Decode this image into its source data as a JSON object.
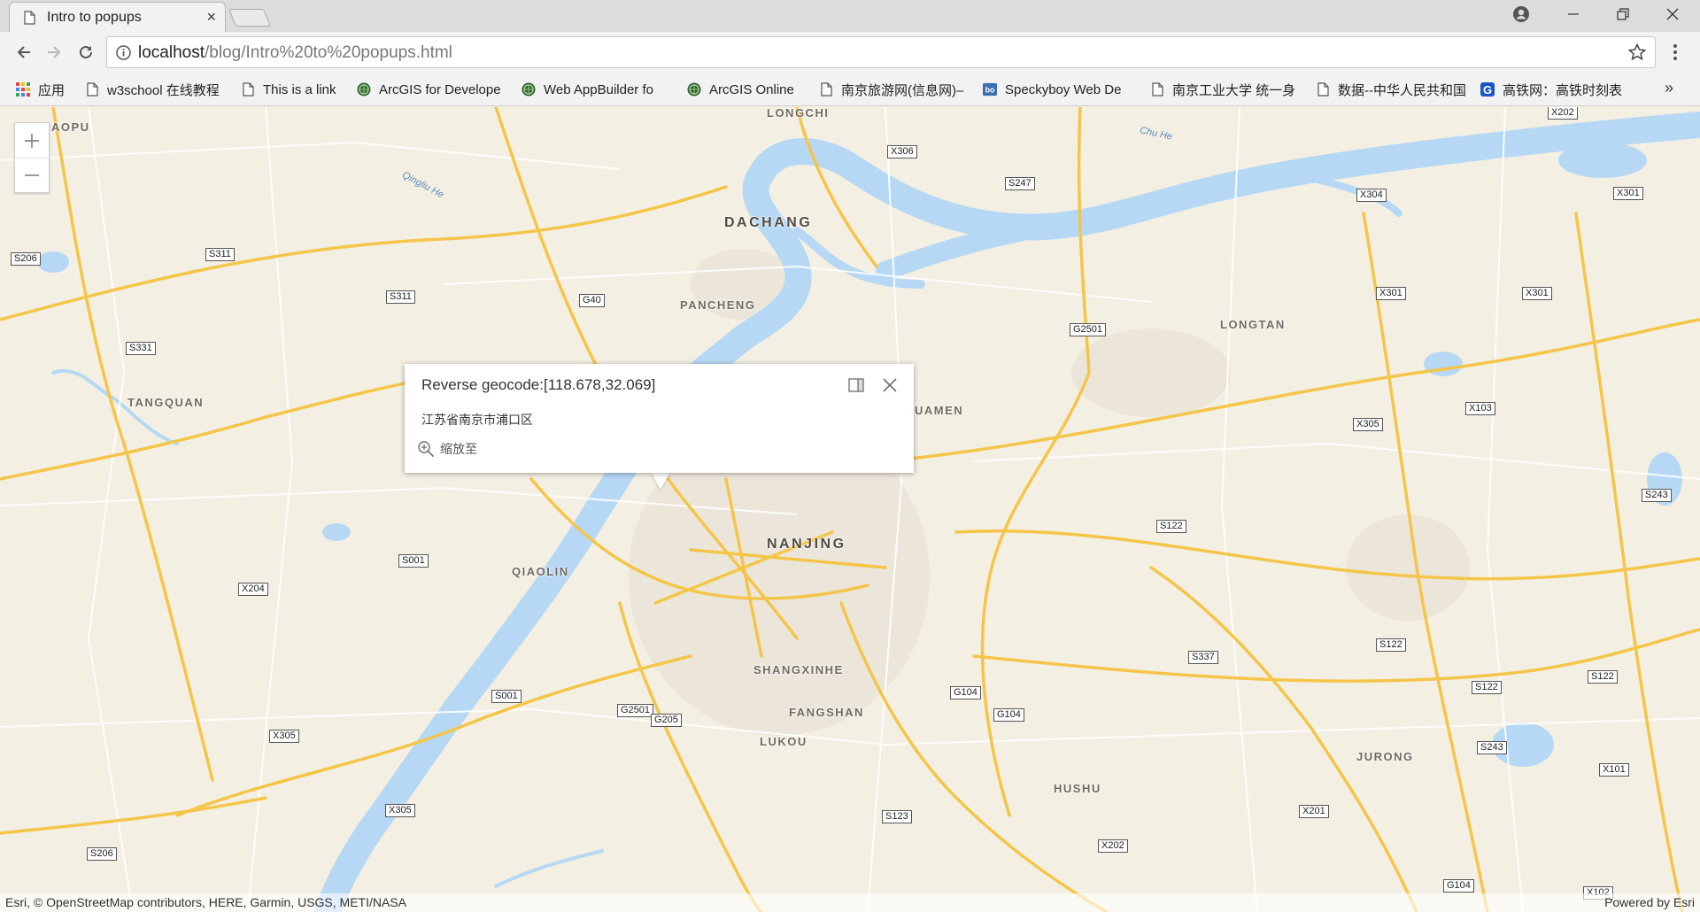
{
  "browser": {
    "tab_title": "Intro to popups",
    "tab_close_glyph": "×",
    "url_host": "localhost",
    "url_path": "/blog/Intro%20to%20popups.html",
    "bookmarks": [
      {
        "label": "应用",
        "icon": "apps-grid-icon"
      },
      {
        "label": "w3school 在线教程",
        "icon": "page-icon"
      },
      {
        "label": "This is a link",
        "icon": "page-icon"
      },
      {
        "label": "ArcGIS for Develope",
        "icon": "globe-icon"
      },
      {
        "label": "Web AppBuilder fo",
        "icon": "globe-icon"
      },
      {
        "label": "ArcGIS Online",
        "icon": "globe-icon"
      },
      {
        "label": "南京旅游网(信息网)–",
        "icon": "page-icon"
      },
      {
        "label": "Speckyboy Web De",
        "icon": "bo-icon"
      },
      {
        "label": "南京工业大学 统一身",
        "icon": "page-icon"
      },
      {
        "label": "数据--中华人民共和国",
        "icon": "page-icon"
      },
      {
        "label": "高铁网：高铁时刻表",
        "icon": "g-icon"
      }
    ],
    "bookmarks_overflow": "»"
  },
  "map": {
    "places": [
      {
        "name": "DACHANG",
        "big": true
      },
      {
        "name": "PANCHENG"
      },
      {
        "name": "LONGCHI"
      },
      {
        "name": "AOPU"
      },
      {
        "name": "TANGQUAN"
      },
      {
        "name": "LONGTAN"
      },
      {
        "name": "UAMEN"
      },
      {
        "name": "NANJING",
        "big": true
      },
      {
        "name": "QIAOLIN"
      },
      {
        "name": "SHANGXINHE"
      },
      {
        "name": "FANGSHAN"
      },
      {
        "name": "LUKOU"
      },
      {
        "name": "HUSHU"
      },
      {
        "name": "JURONG"
      }
    ],
    "water_labels": [
      "Qingliu He",
      "Chu He"
    ],
    "road_shields": [
      "X306",
      "S247",
      "X202",
      "X304",
      "X301",
      "S206",
      "S311",
      "S311",
      "G40",
      "X301",
      "X301",
      "S331",
      "G2501",
      "X305",
      "X103",
      "S243",
      "S122",
      "S001",
      "X204",
      "S001",
      "X305",
      "G2501",
      "G205",
      "G104",
      "G104",
      "S337",
      "S122",
      "S122",
      "S122",
      "S243",
      "X101",
      "X305",
      "S123",
      "X201",
      "X202",
      "S206",
      "G104",
      "X102"
    ],
    "zoom_in_glyph": "+",
    "zoom_out_glyph": "−",
    "attribution_left": "Esri, © OpenStreetMap contributors, HERE, Garmin, USGS, METI/NASA",
    "attribution_right": "Powered by Esri",
    "colors": {
      "land": "#f4efe3",
      "water": "#b6d8f5",
      "major_road": "#f5c54a",
      "minor_road": "#ffffff"
    }
  },
  "popup": {
    "title": "Reverse geocode:[118.678,32.069]",
    "content": "江苏省南京市浦口区",
    "action_label": "缩放至"
  }
}
